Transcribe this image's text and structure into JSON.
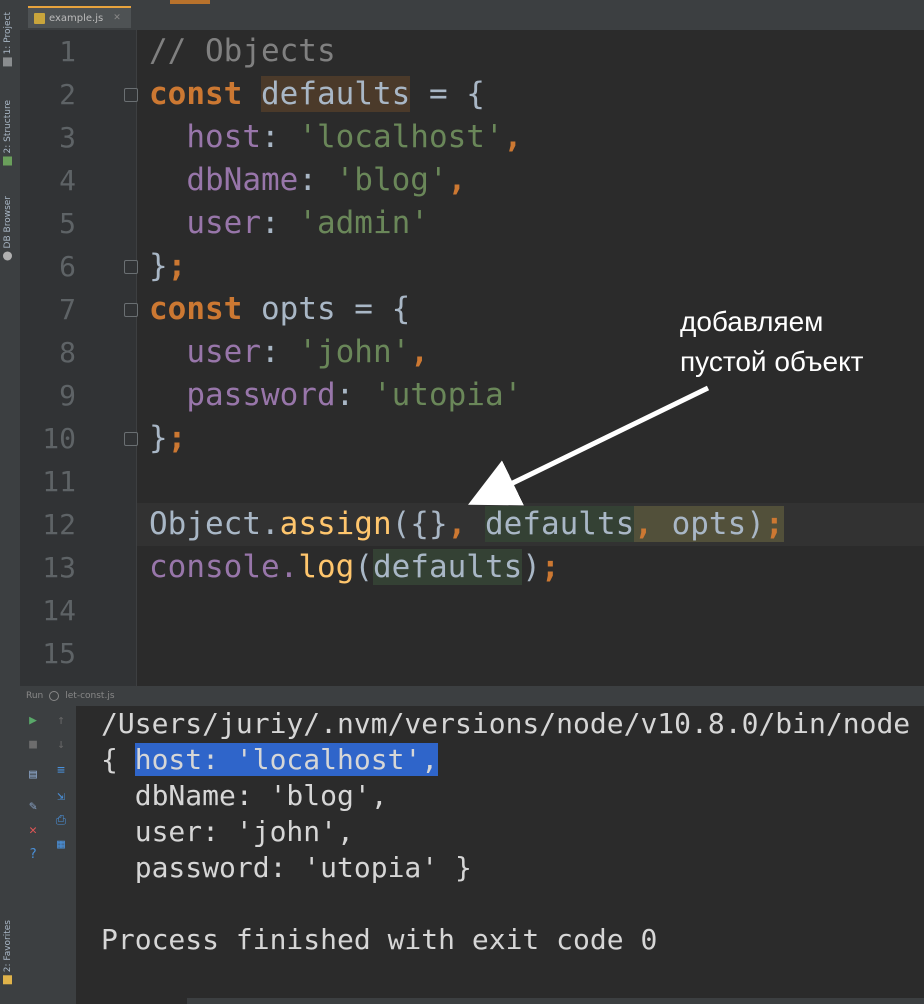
{
  "left_toolstrip": {
    "tabs": [
      "1: Project",
      "2: Structure",
      "DB Browser"
    ],
    "bottom_tab": "2: Favorites"
  },
  "editor_tab": {
    "file_name": "example.js",
    "close_icon": "close-icon"
  },
  "editor": {
    "line_numbers": [
      "1",
      "2",
      "3",
      "4",
      "5",
      "6",
      "7",
      "8",
      "9",
      "10",
      "11",
      "12",
      "13",
      "14",
      "15"
    ],
    "lines": {
      "l1": "// Objects",
      "l2_kw": "const",
      "l2_name": "defaults",
      "l2_rest": " = {",
      "l3_prop": "host",
      "l3_colon": ": ",
      "l3_val": "'localhost'",
      "l3_end": ",",
      "l4_prop": "dbName",
      "l4_colon": ": ",
      "l4_val": "'blog'",
      "l4_end": ",",
      "l5_prop": "user",
      "l5_colon": ": ",
      "l5_val": "'admin'",
      "l6_brace": "}",
      "l6_end": ";",
      "l7_kw": "const",
      "l7_name": " opts = {",
      "l8_prop": "user",
      "l8_colon": ": ",
      "l8_val": "'john'",
      "l8_end": ",",
      "l9_prop": "password",
      "l9_colon": ": ",
      "l9_val": "'utopia'",
      "l10_brace": "}",
      "l10_end": ";",
      "l12_obj": "Object.",
      "l12_fn": "assign",
      "l12_open": "({}",
      "l12_comma": ", ",
      "l12_arg1": "defaults",
      "l12_comma2": ", ",
      "l12_arg2": "opts",
      "l12_close": ")",
      "l12_end": ";",
      "l13_obj": "console.",
      "l13_fn": "log",
      "l13_open": "(",
      "l13_arg": "defaults",
      "l13_close": ")",
      "l13_end": ";"
    }
  },
  "annotation": {
    "line1": "добавляем",
    "line2": "пустой объект"
  },
  "run_panel": {
    "label": "Run",
    "config": "let-const.js",
    "output": {
      "path": "/Users/juriy/.nvm/versions/node/v10.8.0/bin/node",
      "o1_open": "{ ",
      "o1_selected": "host: 'localhost',",
      "o2": "  dbName: 'blog',",
      "o3": "  user: 'john',",
      "o4": "  password: 'utopia' }",
      "o5": "",
      "o6": "Process finished with exit code 0"
    }
  },
  "colors": {
    "keyword": "#cc7832",
    "string": "#6a8759",
    "property": "#9876aa",
    "comment": "#808080",
    "function": "#ffc66d",
    "selection": "#2f65ca"
  }
}
